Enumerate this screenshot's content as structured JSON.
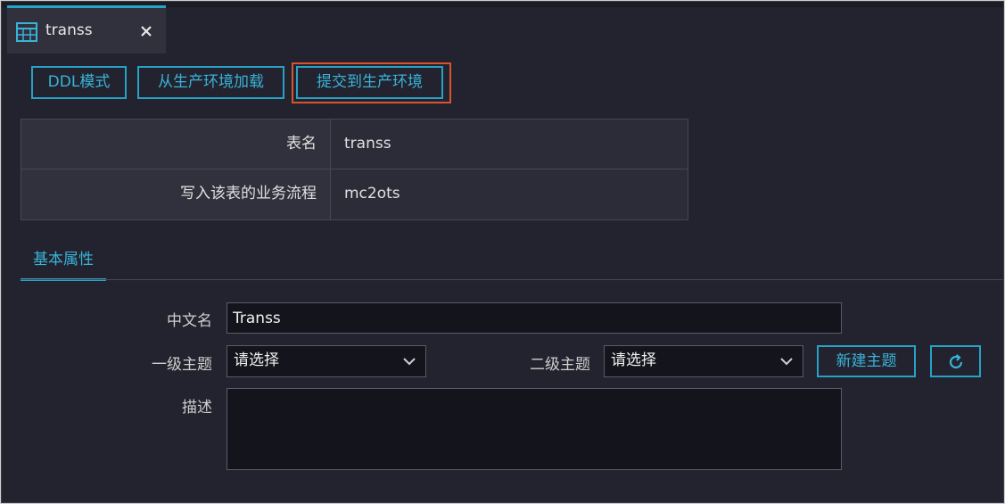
{
  "tab": {
    "title": "transs",
    "icon": "table-icon",
    "close_icon": "close-icon"
  },
  "toolbar": {
    "ddl_label": "DDL模式",
    "load_label": "从生产环境加载",
    "submit_label": "提交到生产环境"
  },
  "table_info": {
    "rows": [
      {
        "key": "表名",
        "value": "transs"
      },
      {
        "key": "写入该表的业务流程",
        "value": "mc2ots"
      }
    ]
  },
  "section": {
    "tab_label": "基本属性"
  },
  "form": {
    "chinese_name_label": "中文名",
    "chinese_name_value": "Transs",
    "level1_label": "一级主题",
    "level1_value": "请选择",
    "level2_label": "二级主题",
    "level2_value": "请选择",
    "new_topic_label": "新建主题",
    "refresh_icon": "refresh-icon",
    "description_label": "描述",
    "description_value": ""
  },
  "colors": {
    "accent": "#2aa3c8",
    "background": "#22232e",
    "highlight": "#d9532c"
  }
}
